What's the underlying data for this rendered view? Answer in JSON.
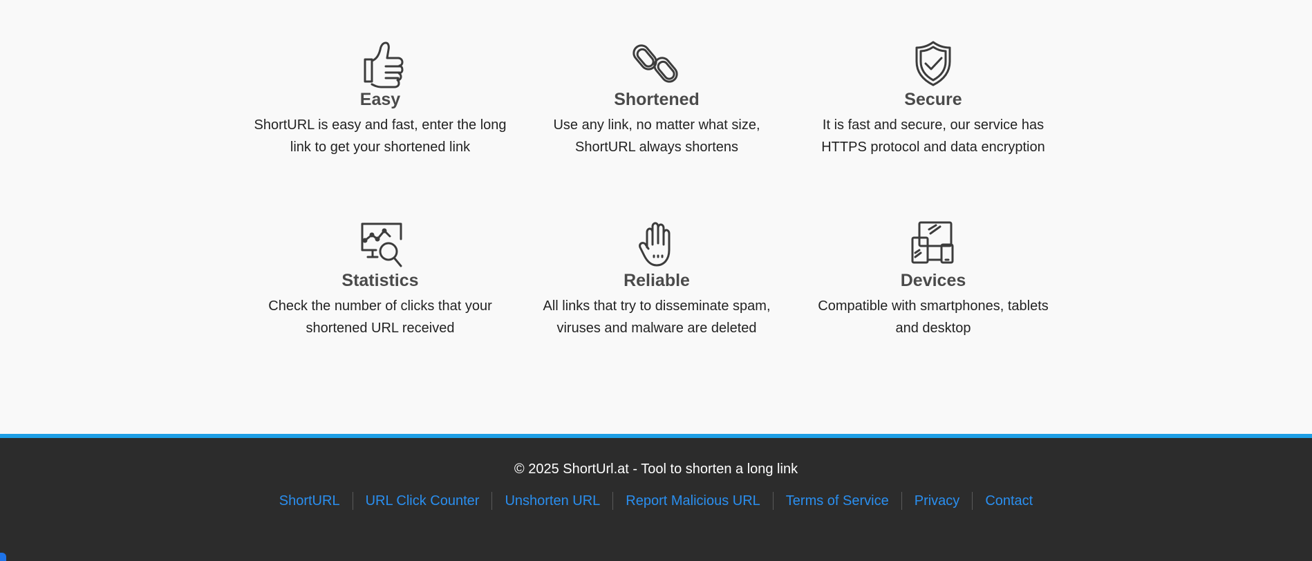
{
  "features": [
    {
      "icon": "thumbs-up-icon",
      "title": "Easy",
      "line1": "ShortURL is easy and fast, enter the long",
      "line2": "link to get your shortened link"
    },
    {
      "icon": "chain-link-icon",
      "title": "Shortened",
      "line1": "Use any link, no matter what size,",
      "line2": "ShortURL always shortens"
    },
    {
      "icon": "shield-check-icon",
      "title": "Secure",
      "line1": "It is fast and secure, our service has",
      "line2": "HTTPS protocol and data encryption"
    },
    {
      "icon": "chart-magnifier-icon",
      "title": "Statistics",
      "line1": "Check the number of clicks that your",
      "line2": "shortened URL received"
    },
    {
      "icon": "hand-icon",
      "title": "Reliable",
      "line1": "All links that try to disseminate spam,",
      "line2": "viruses and malware are deleted"
    },
    {
      "icon": "devices-icon",
      "title": "Devices",
      "line1": "Compatible with smartphones, tablets",
      "line2": "and desktop"
    }
  ],
  "footer": {
    "copyright": "© 2025 ShortUrl.at - Tool to shorten a long link",
    "links": [
      "ShortURL",
      "URL Click Counter",
      "Unshorten URL",
      "Report Malicious URL",
      "Terms of Service",
      "Privacy",
      "Contact"
    ]
  },
  "colors": {
    "background": "#f9f9f9",
    "footer_bg": "#2c2c2c",
    "footer_accent": "#1e9fe6",
    "link": "#2a8ff0"
  }
}
